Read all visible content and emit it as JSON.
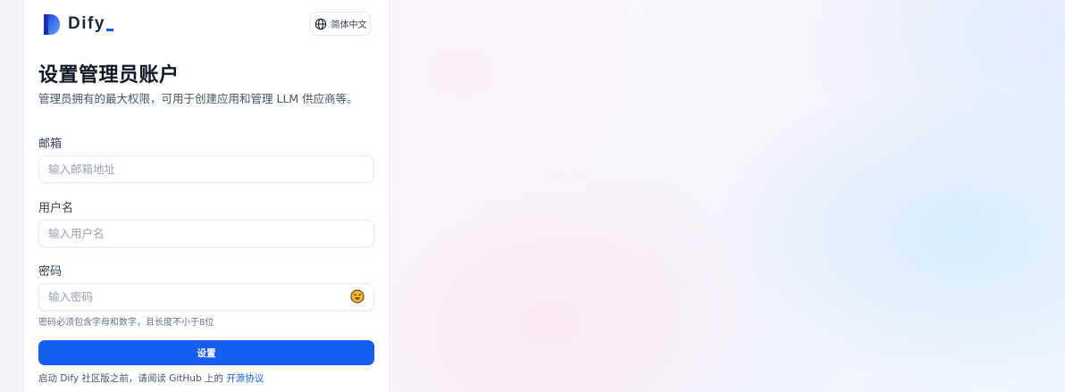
{
  "brand": {
    "name": "Dify",
    "accent": "#155eef"
  },
  "language": {
    "label": "简体中文",
    "icon": "globe-icon"
  },
  "form": {
    "title": "设置管理员账户",
    "subtitle": "管理员拥有的最大权限，可用于创建应用和管理 LLM 供应商等。",
    "email": {
      "label": "邮箱",
      "placeholder": "输入邮箱地址",
      "value": ""
    },
    "username": {
      "label": "用户名",
      "placeholder": "输入用户名",
      "value": ""
    },
    "password": {
      "label": "密码",
      "placeholder": "输入密码",
      "value": "",
      "toggle_icon": "emoji-face-icon",
      "hint": "密码必须包含字母和数字，且长度不小于8位"
    },
    "submit_label": "设置"
  },
  "footer": {
    "prefix": "启动 Dify 社区版之前，请阅读 GitHub 上的",
    "link_label": "开源协议"
  }
}
